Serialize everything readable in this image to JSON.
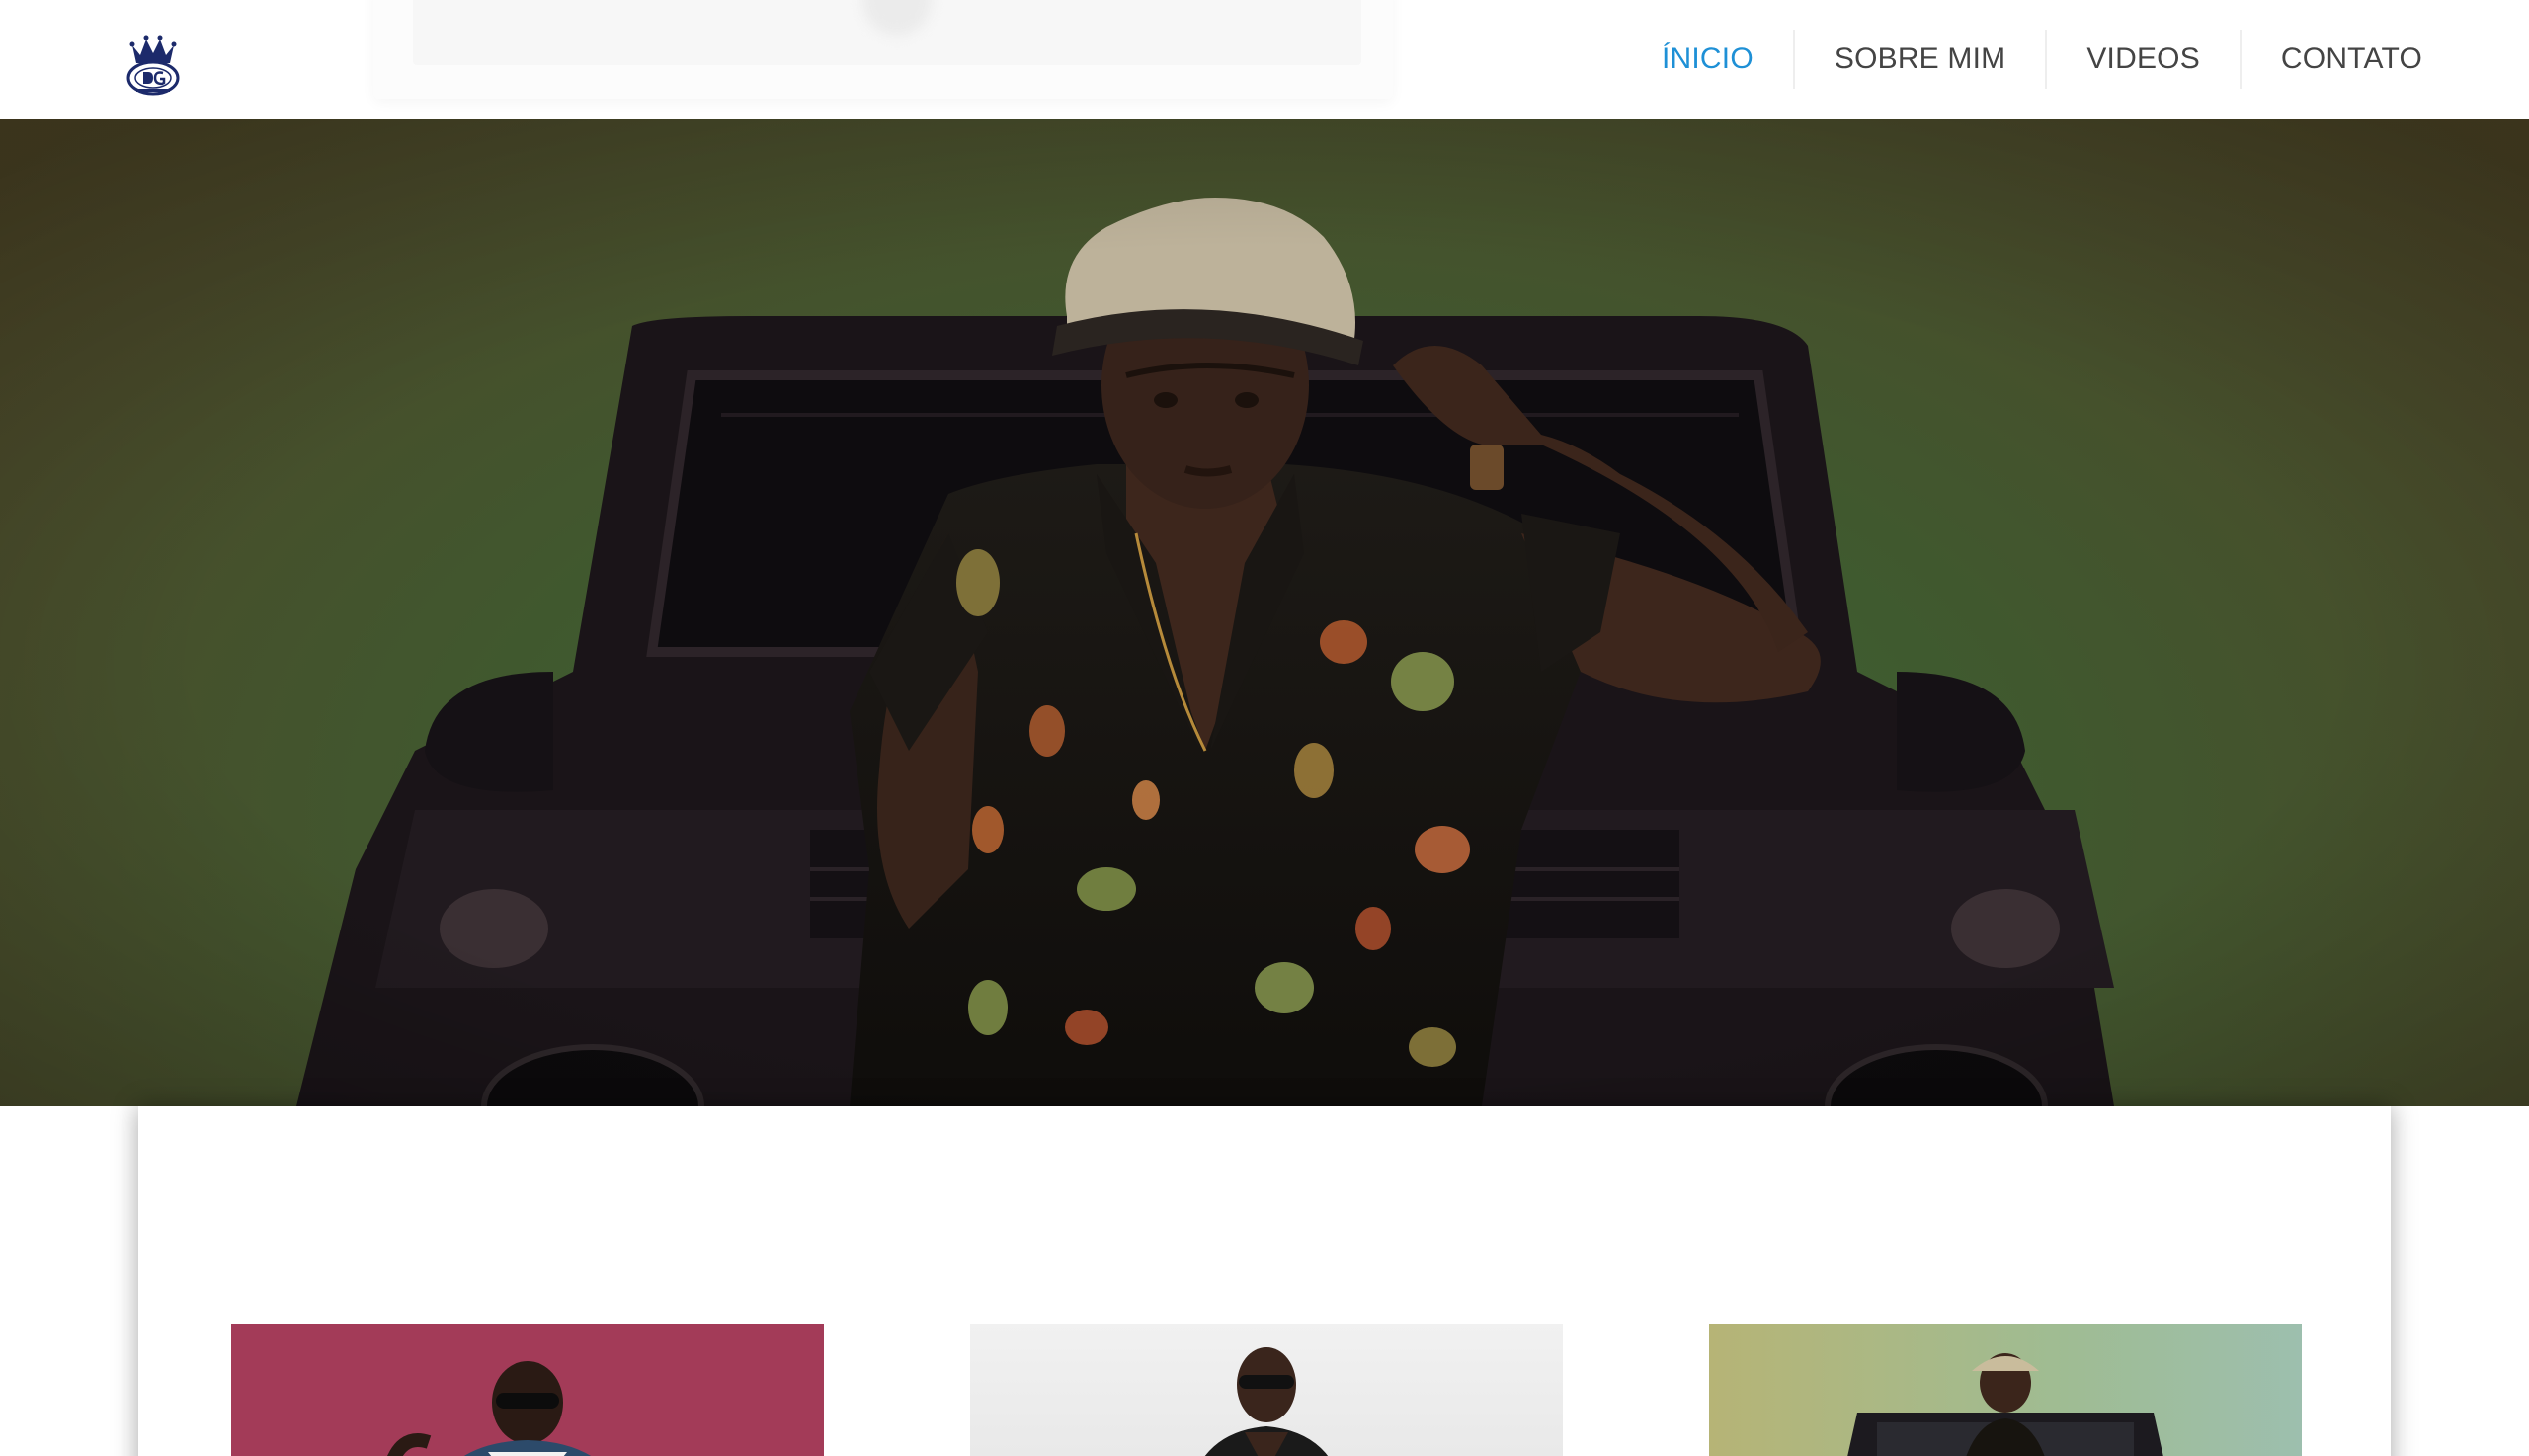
{
  "header": {
    "logo_name": "DG crown logo",
    "nav": [
      {
        "label": "ÍNICIO",
        "active": true
      },
      {
        "label": "SOBRE MIM",
        "active": false
      },
      {
        "label": "VIDEOS",
        "active": false
      },
      {
        "label": "CONTATO",
        "active": false
      }
    ]
  },
  "hero": {
    "image": "man in floral shirt and hat posing in front of black SUV"
  },
  "gallery": {
    "items": [
      {
        "image": "artist with sunglasses on magenta background"
      },
      {
        "image": "artist with sunglasses on light grey background"
      },
      {
        "image": "artist with hat in front of SUV on green background"
      }
    ]
  },
  "colors": {
    "nav_active": "#1e90d6",
    "nav_text": "#444444",
    "logo_blue": "#1c2a6b"
  }
}
